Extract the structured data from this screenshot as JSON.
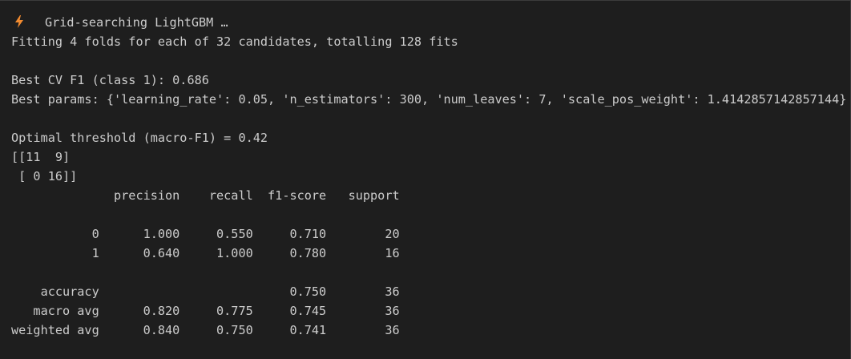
{
  "status": {
    "icon": "lightning-bolt-icon",
    "icon_color": "#f28b30",
    "text": "Grid-searching LightGBM …"
  },
  "lines": {
    "fitting": "Fitting 4 folds for each of 32 candidates, totalling 128 fits",
    "best_cv": "Best CV F1 (class 1): 0.686",
    "best_params": "Best params: {'learning_rate': 0.05, 'n_estimators': 300, 'num_leaves': 7, 'scale_pos_weight': 1.4142857142857144}",
    "threshold": "Optimal threshold (macro-F1) = 0.42"
  },
  "confusion_matrix": [
    "[[11  9]",
    " [ 0 16]]"
  ],
  "report": {
    "header": "              precision    recall  f1-score   support",
    "rows": [
      "           0      1.000     0.550     0.710        20",
      "           1      0.640     1.000     0.780        16",
      "    accuracy                          0.750        36",
      "   macro avg      0.820     0.775     0.745        36",
      "weighted avg      0.840     0.750     0.741        36"
    ]
  },
  "colors": {
    "background": "#1e1e1e",
    "text": "#cccccc",
    "accent": "#f28b30"
  }
}
